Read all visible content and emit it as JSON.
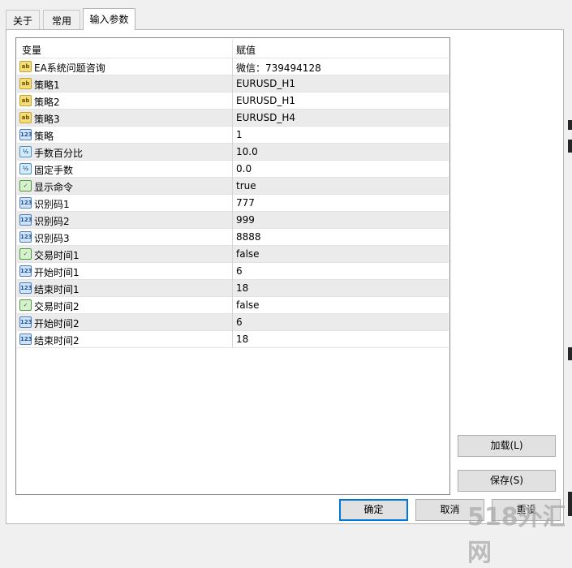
{
  "tabs": [
    {
      "label": "关于"
    },
    {
      "label": "常用"
    },
    {
      "label": "输入参数"
    }
  ],
  "grid": {
    "header": {
      "variable": "变量",
      "value": "赋值"
    },
    "rows": [
      {
        "name": "EA系统问题咨询",
        "value": "微信：739494128",
        "type_icon": "string-type-icon"
      },
      {
        "name": "策略1",
        "value": "EURUSD_H1",
        "type_icon": "string-type-icon"
      },
      {
        "name": "策略2",
        "value": "EURUSD_H1",
        "type_icon": "string-type-icon"
      },
      {
        "name": "策略3",
        "value": "EURUSD_H4",
        "type_icon": "string-type-icon"
      },
      {
        "name": "策略",
        "value": "1",
        "type_icon": "integer-type-icon"
      },
      {
        "name": "手数百分比",
        "value": "10.0",
        "type_icon": "double-type-icon"
      },
      {
        "name": "固定手数",
        "value": "0.0",
        "type_icon": "double-type-icon"
      },
      {
        "name": "显示命令",
        "value": "true",
        "type_icon": "boolean-type-icon"
      },
      {
        "name": "识别码1",
        "value": "777",
        "type_icon": "integer-type-icon"
      },
      {
        "name": "识别码2",
        "value": "999",
        "type_icon": "integer-type-icon"
      },
      {
        "name": "识别码3",
        "value": "8888",
        "type_icon": "integer-type-icon"
      },
      {
        "name": "交易时间1",
        "value": "false",
        "type_icon": "boolean-type-icon"
      },
      {
        "name": "开始时间1",
        "value": "6",
        "type_icon": "integer-type-icon"
      },
      {
        "name": "结束时间1",
        "value": "18",
        "type_icon": "integer-type-icon"
      },
      {
        "name": "交易时间2",
        "value": "false",
        "type_icon": "boolean-type-icon"
      },
      {
        "name": "开始时间2",
        "value": "6",
        "type_icon": "integer-type-icon"
      },
      {
        "name": "结束时间2",
        "value": "18",
        "type_icon": "integer-type-icon"
      }
    ]
  },
  "icons": {
    "string": "ab",
    "integer": "123",
    "double": "½",
    "boolean": "✓"
  },
  "buttons": {
    "load": "加载(L)",
    "save": "保存(S)",
    "ok": "确定",
    "cancel": "取消",
    "reset": "重设"
  },
  "watermark": "518外汇网",
  "colors": {
    "accent": "#0078d7",
    "row_alt": "#ebebeb",
    "window_bg": "#f0f0f0"
  }
}
